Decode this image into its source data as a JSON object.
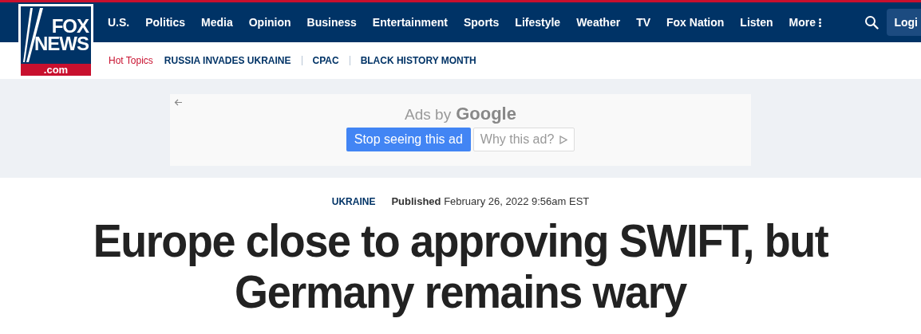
{
  "logo": {
    "line_1": "FOX",
    "line_2": "NEWS",
    "domain": ".com"
  },
  "nav": {
    "items": [
      "U.S.",
      "Politics",
      "Media",
      "Opinion",
      "Business",
      "Entertainment",
      "Sports",
      "Lifestyle",
      "Weather",
      "TV",
      "Fox Nation",
      "Listen"
    ],
    "more": "More",
    "login": "Logi"
  },
  "hot_topics": {
    "label": "Hot Topics",
    "items": [
      "RUSSIA INVADES UKRAINE",
      "CPAC",
      "BLACK HISTORY MONTH"
    ]
  },
  "ad": {
    "attribution": "Ads by",
    "brand": "Google",
    "stop_button": "Stop seeing this ad",
    "why_button": "Why this ad?"
  },
  "article": {
    "category": "UKRAINE",
    "published": "**Published** February 26, 2022 9:56am EST",
    "headline": "Europe close to approving SWIFT, but Germany remains wary"
  }
}
